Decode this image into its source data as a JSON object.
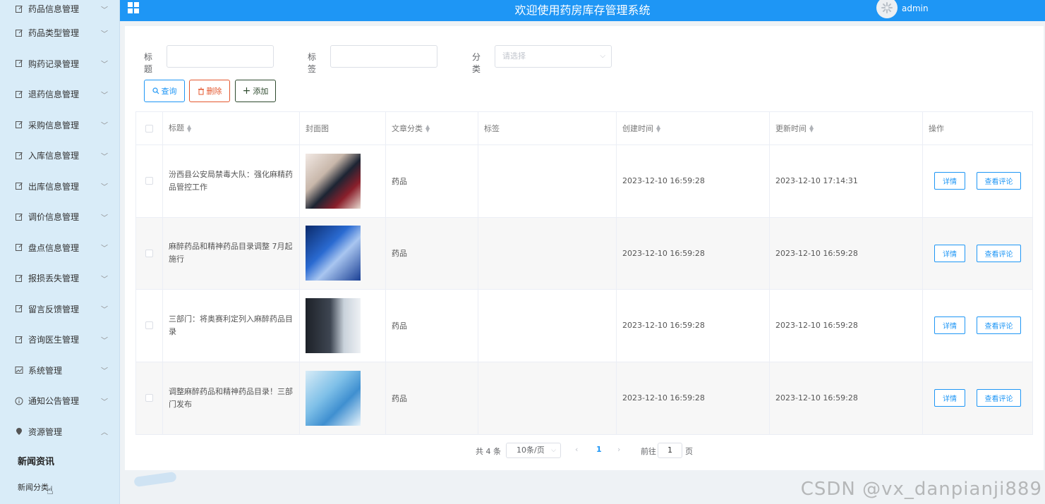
{
  "header": {
    "title": "欢迎使用药房库存管理系统",
    "username": "admin"
  },
  "sidebar": {
    "items": [
      {
        "label": "药品信息管理",
        "icon": "file-edit-icon"
      },
      {
        "label": "药品类型管理",
        "icon": "file-edit-icon"
      },
      {
        "label": "购药记录管理",
        "icon": "file-edit-icon"
      },
      {
        "label": "退药信息管理",
        "icon": "file-edit-icon"
      },
      {
        "label": "采购信息管理",
        "icon": "file-edit-icon"
      },
      {
        "label": "入库信息管理",
        "icon": "file-edit-icon"
      },
      {
        "label": "出库信息管理",
        "icon": "file-edit-icon"
      },
      {
        "label": "调价信息管理",
        "icon": "file-edit-icon"
      },
      {
        "label": "盘点信息管理",
        "icon": "file-edit-icon"
      },
      {
        "label": "报损丢失管理",
        "icon": "file-edit-icon"
      },
      {
        "label": "留言反馈管理",
        "icon": "file-edit-icon"
      },
      {
        "label": "咨询医生管理",
        "icon": "file-edit-icon"
      },
      {
        "label": "系统管理",
        "icon": "picture-icon"
      },
      {
        "label": "通知公告管理",
        "icon": "info-circle-icon"
      },
      {
        "label": "资源管理",
        "icon": "pin-icon"
      }
    ],
    "subitems": [
      {
        "label": "新闻资讯"
      },
      {
        "label": "新闻分类"
      }
    ]
  },
  "search": {
    "title_label": "标题",
    "tag_label": "标签",
    "category_label": "分类",
    "category_placeholder": "请选择"
  },
  "toolbar": {
    "query_label": "查询",
    "delete_label": "删除",
    "add_label": "添加"
  },
  "table": {
    "headers": {
      "title": "标题",
      "cover": "封面图",
      "category": "文章分类",
      "tag": "标签",
      "created": "创建时间",
      "updated": "更新时间",
      "ops": "操作"
    },
    "detail_label": "详情",
    "comment_label": "查看评论",
    "rows": [
      {
        "title": "汾西县公安局禁毒大队：强化麻精药品管控工作",
        "category": "药品",
        "tag": "",
        "created": "2023-12-10 16:59:28",
        "updated": "2023-12-10 17:14:31"
      },
      {
        "title": "麻醉药品和精神药品目录调整 7月起施行",
        "category": "药品",
        "tag": "",
        "created": "2023-12-10 16:59:28",
        "updated": "2023-12-10 16:59:28"
      },
      {
        "title": "三部门：将奥赛利定列入麻醉药品目录",
        "category": "药品",
        "tag": "",
        "created": "2023-12-10 16:59:28",
        "updated": "2023-12-10 16:59:28"
      },
      {
        "title": "调整麻醉药品和精神药品目录！三部门发布",
        "category": "药品",
        "tag": "",
        "created": "2023-12-10 16:59:28",
        "updated": "2023-12-10 16:59:28"
      }
    ]
  },
  "pagination": {
    "total": "共 4 条",
    "page_size": "10条/页",
    "current_page": "1",
    "goto_label": "前往",
    "goto_value": "1",
    "page_unit": "页"
  },
  "watermark": "CSDN @vx_danpianji889",
  "colors": {
    "primary": "#1e96f5",
    "danger": "#e4572e",
    "sidebar_bg": "#d9ecf8"
  }
}
